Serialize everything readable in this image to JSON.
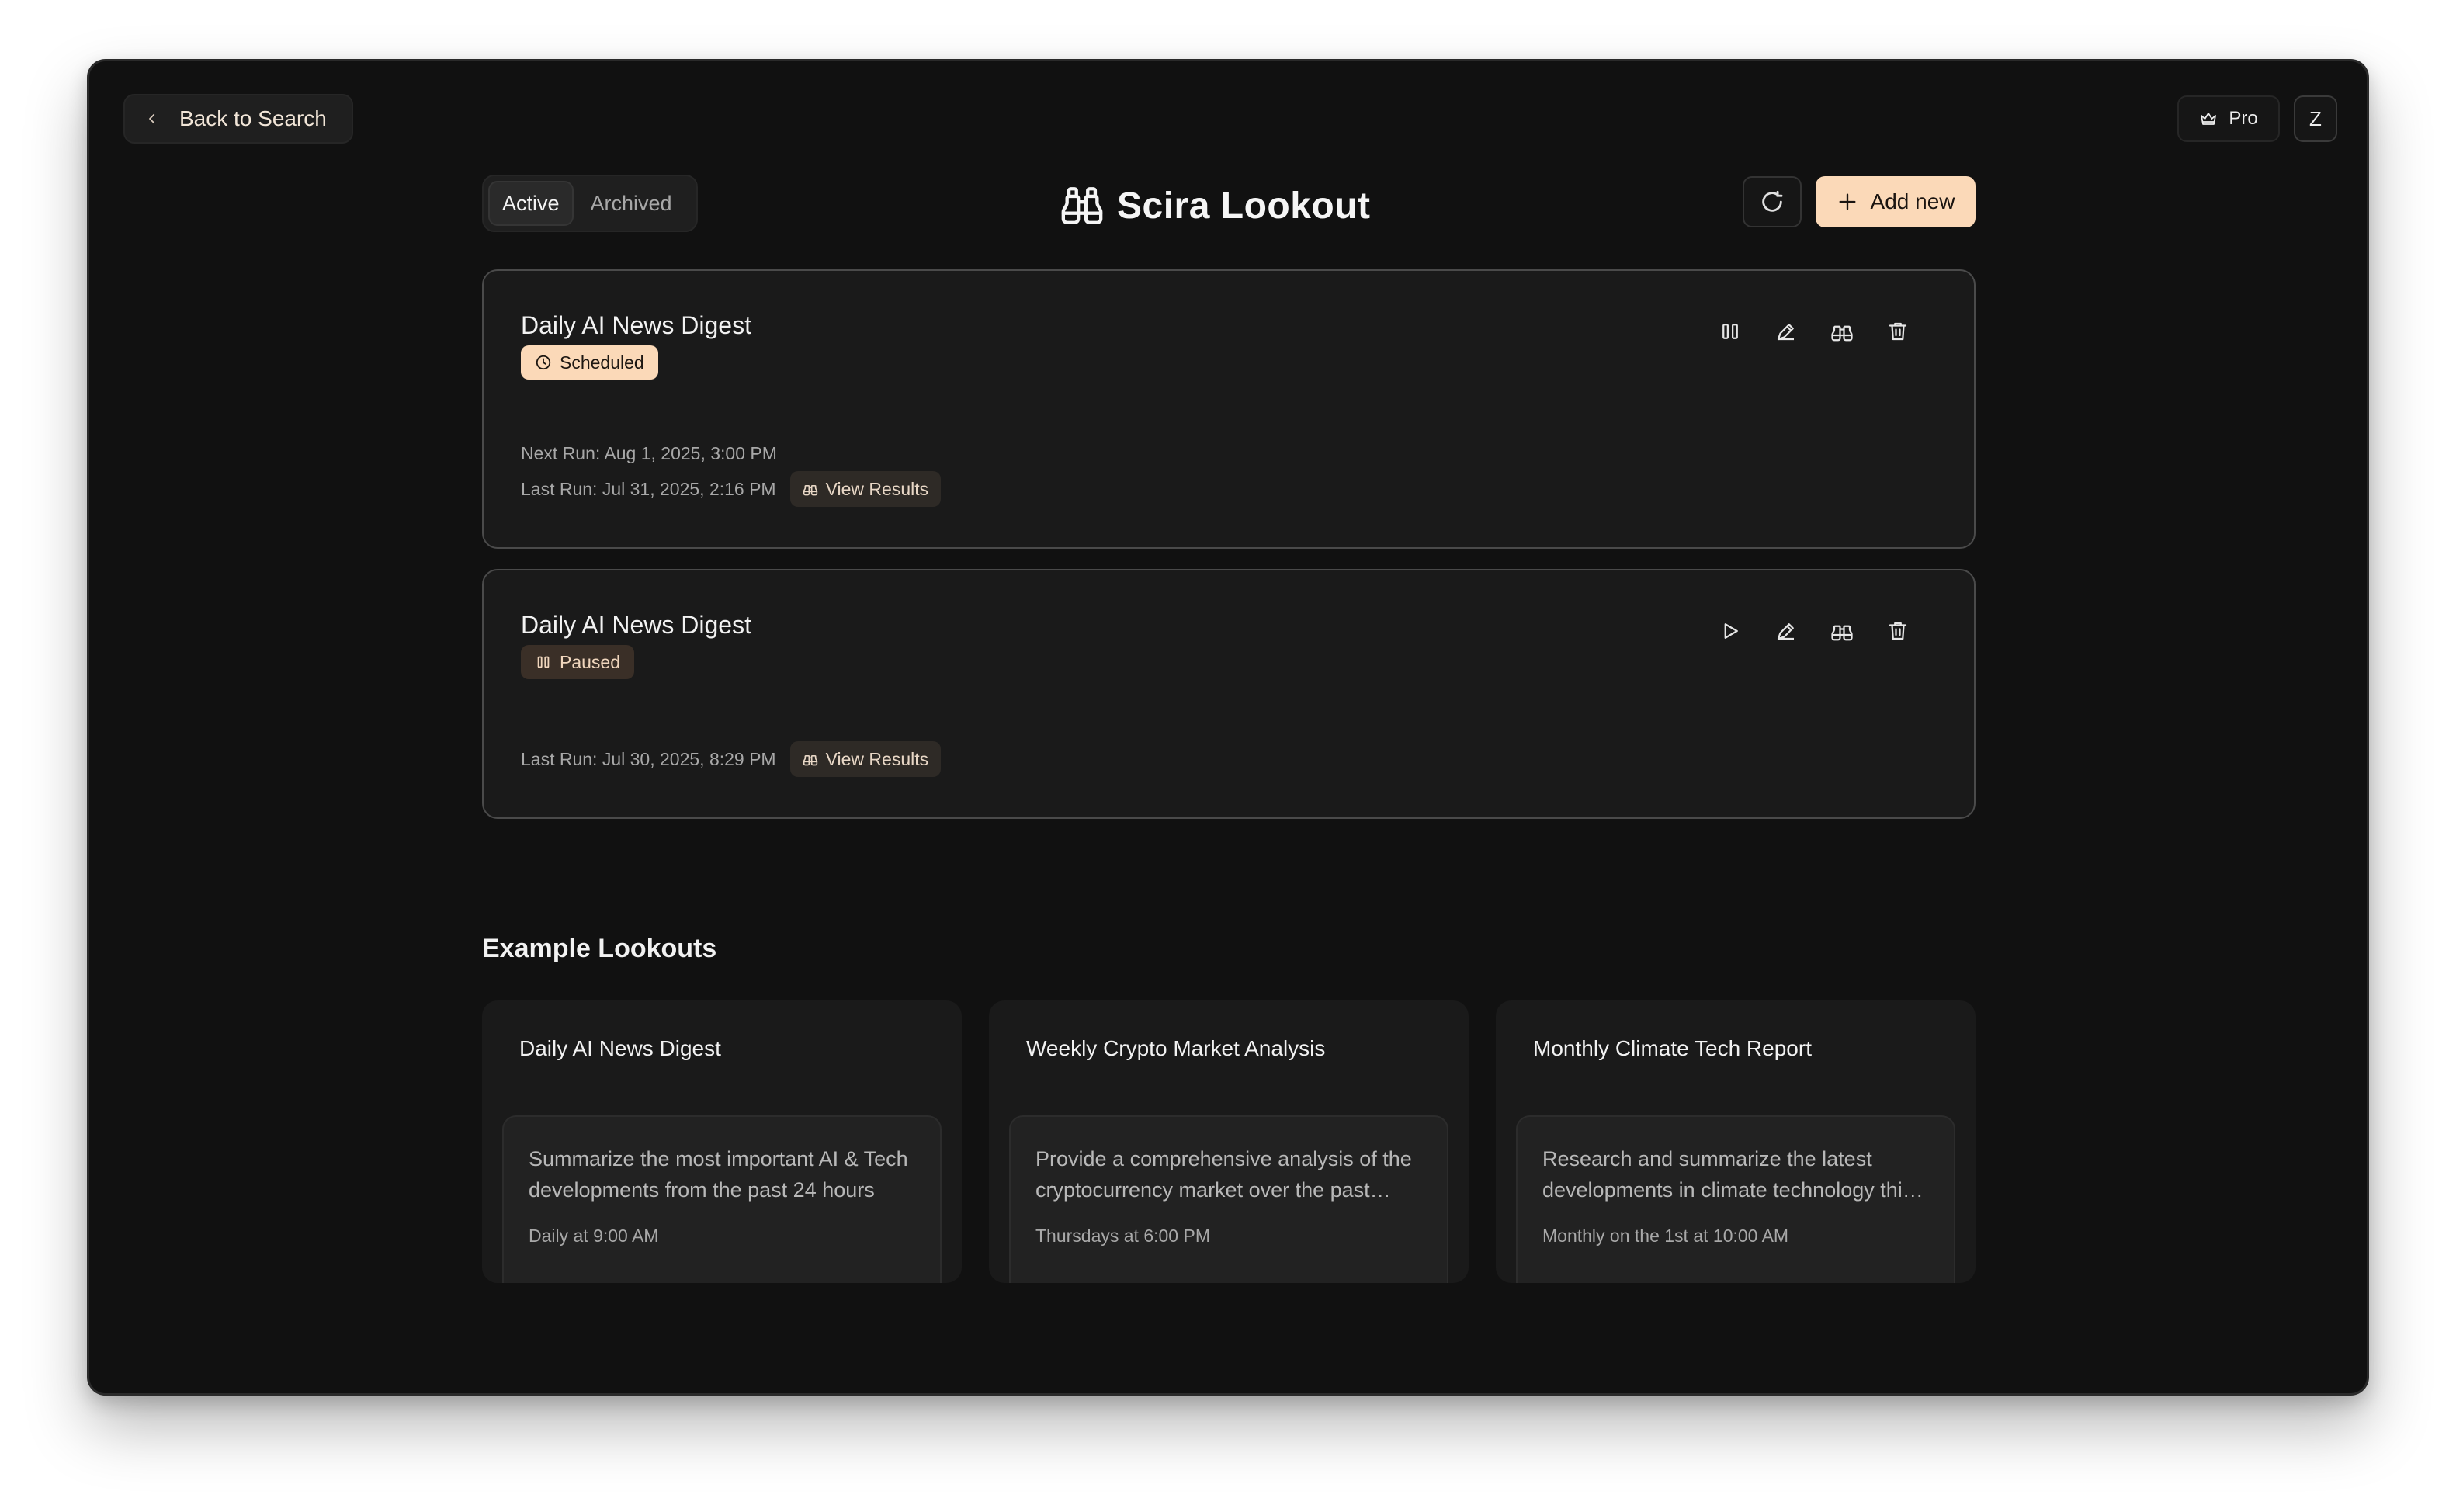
{
  "colors": {
    "accent": "#fbd9b8",
    "background": "#111111",
    "card": "#1a1a1a"
  },
  "topbar": {
    "back_label": "Back to Search",
    "pro_label": "Pro",
    "avatar_initial": "Z"
  },
  "header": {
    "tabs": [
      {
        "label": "Active",
        "selected": true
      },
      {
        "label": "Archived",
        "selected": false
      }
    ],
    "title": "Scira Lookout",
    "add_label": "Add new"
  },
  "lookouts": [
    {
      "title": "Daily AI News Digest",
      "status": "Scheduled",
      "next_run": "Next Run: Aug 1, 2025, 3:00 PM",
      "last_run": "Last Run: Jul 31, 2025, 2:16 PM",
      "view_label": "View Results",
      "primary_action_icon": "pause-icon"
    },
    {
      "title": "Daily AI News Digest",
      "status": "Paused",
      "last_run": "Last Run: Jul 30, 2025, 8:29 PM",
      "view_label": "View Results",
      "primary_action_icon": "play-icon"
    }
  ],
  "examples": {
    "heading": "Example Lookouts",
    "items": [
      {
        "title": "Daily AI News Digest",
        "prompt": "Summarize the most important AI & Tech developments from the past 24 hours",
        "frequency": "Daily at 9:00 AM"
      },
      {
        "title": "Weekly Crypto Market Analysis",
        "prompt": "Provide a comprehensive analysis of the cryptocurrency market over the past week",
        "frequency": "Thursdays at 6:00 PM"
      },
      {
        "title": "Monthly Climate Tech Report",
        "prompt": "Research and summarize the latest developments in climate technology this month",
        "frequency": "Monthly on the 1st at 10:00 AM"
      }
    ]
  }
}
